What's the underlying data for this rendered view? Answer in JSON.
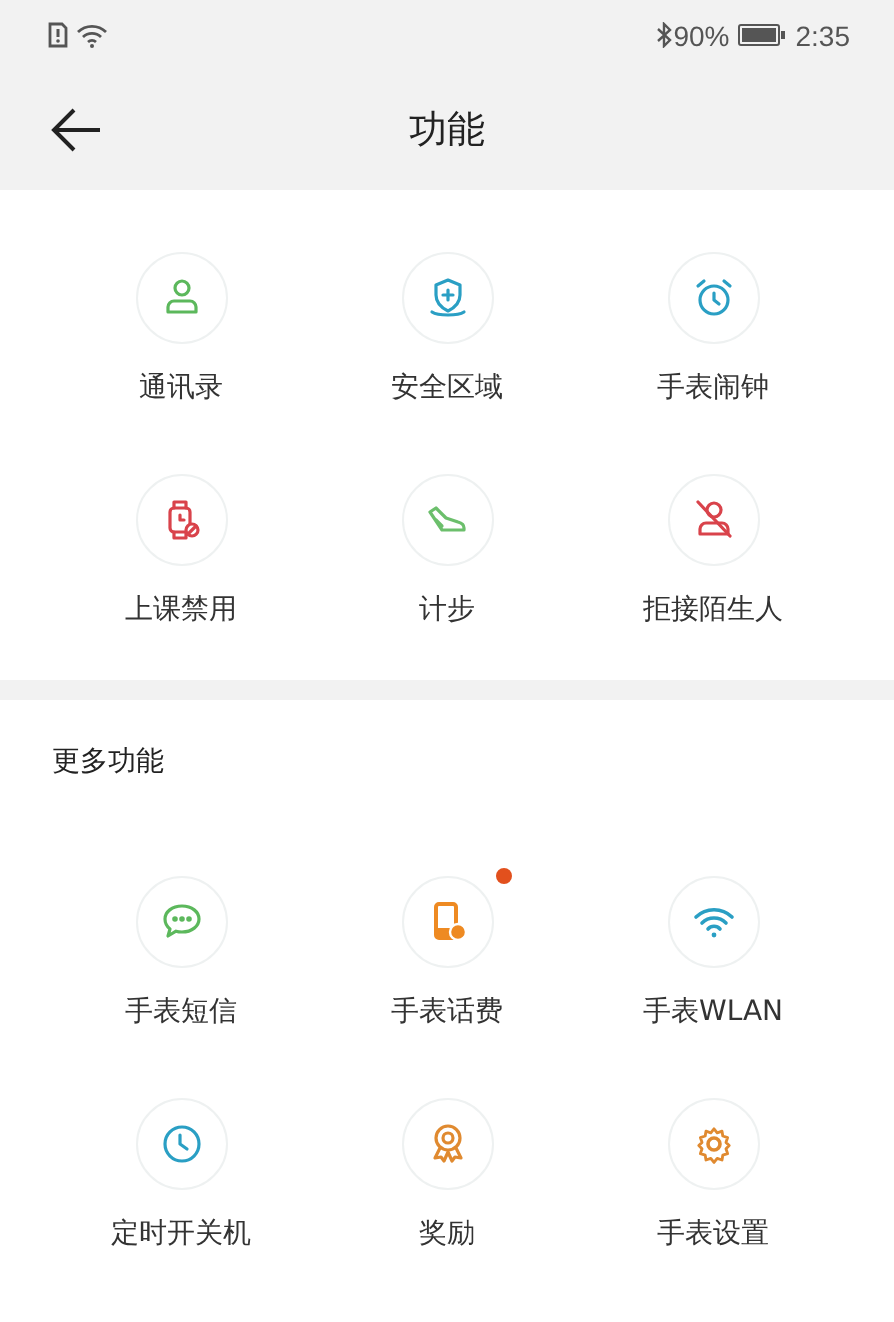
{
  "status_bar": {
    "battery": "90%",
    "time": "2:35"
  },
  "header": {
    "title": "功能"
  },
  "main_features": [
    {
      "label": "通讯录",
      "kind": "person",
      "color": "#5cb85c",
      "badge": false
    },
    {
      "label": "安全区域",
      "kind": "shield",
      "color": "#2a9fc4",
      "badge": false
    },
    {
      "label": "手表闹钟",
      "kind": "alarm",
      "color": "#2a9fc4",
      "badge": false
    },
    {
      "label": "上课禁用",
      "kind": "watch-ban",
      "color": "#d9434b",
      "badge": false
    },
    {
      "label": "计步",
      "kind": "shoe",
      "color": "#6cbf6c",
      "badge": false
    },
    {
      "label": "拒接陌生人",
      "kind": "person-ban",
      "color": "#d9434b",
      "badge": false
    }
  ],
  "more_features": {
    "title": "更多功能",
    "items": [
      {
        "label": "手表短信",
        "kind": "chat",
        "color": "#5cb85c",
        "badge": false
      },
      {
        "label": "手表话费",
        "kind": "phone-bill",
        "color": "#ee8a22",
        "badge": true
      },
      {
        "label": "手表WLAN",
        "kind": "wifi",
        "color": "#2a9fc4",
        "badge": false
      },
      {
        "label": "定时开关机",
        "kind": "clock",
        "color": "#2a9fc4",
        "badge": false
      },
      {
        "label": "奖励",
        "kind": "medal",
        "color": "#e08a30",
        "badge": false
      },
      {
        "label": "手表设置",
        "kind": "gear",
        "color": "#e08a30",
        "badge": false
      }
    ]
  }
}
